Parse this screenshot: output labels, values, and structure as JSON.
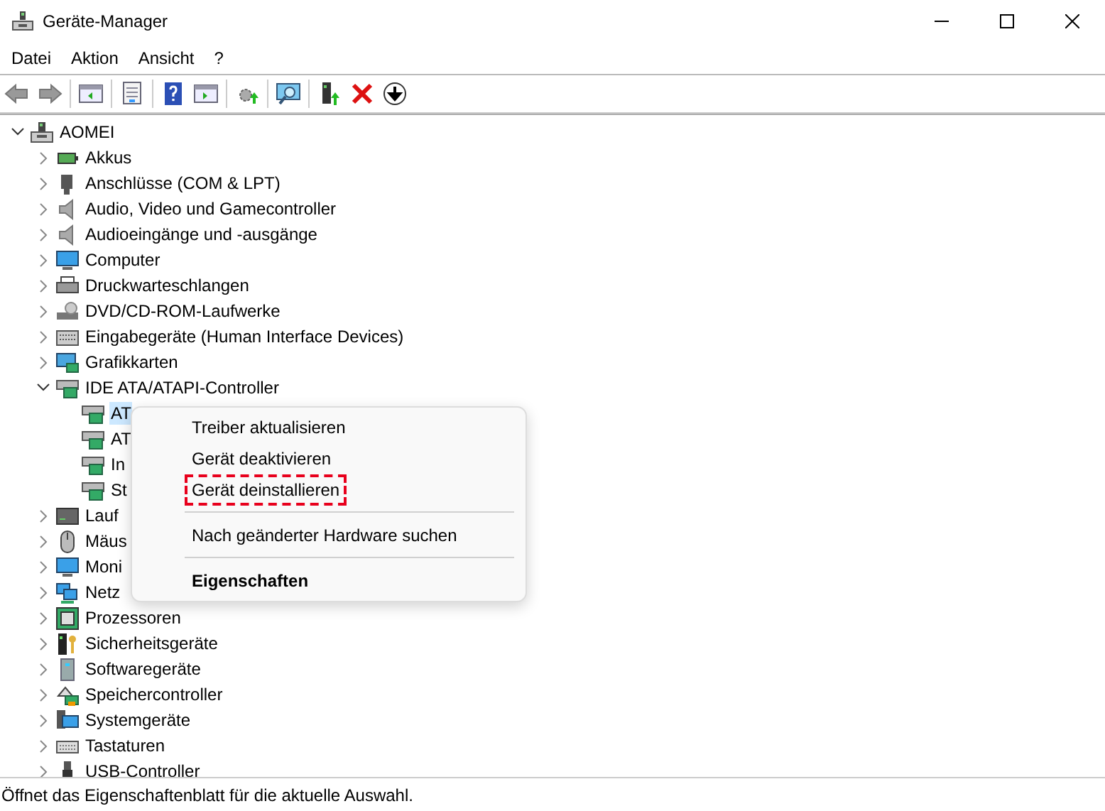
{
  "window": {
    "title": "Geräte-Manager"
  },
  "menu_bar": [
    "Datei",
    "Aktion",
    "Ansicht",
    "?"
  ],
  "tree": [
    {
      "label": "AOMEI",
      "expanded": true,
      "selected": false,
      "children": [
        {
          "label": "Akkus",
          "expanded": false,
          "selected": false
        },
        {
          "label": "Anschlüsse (COM & LPT)",
          "expanded": false,
          "selected": false
        },
        {
          "label": "Audio, Video und Gamecontroller",
          "expanded": false,
          "selected": false
        },
        {
          "label": "Audioeingänge und -ausgänge",
          "expanded": false,
          "selected": false
        },
        {
          "label": "Computer",
          "expanded": false,
          "selected": false
        },
        {
          "label": "Druckwarteschlangen",
          "expanded": false,
          "selected": false
        },
        {
          "label": "DVD/CD-ROM-Laufwerke",
          "expanded": false,
          "selected": false
        },
        {
          "label": "Eingabegeräte (Human Interface Devices)",
          "expanded": false,
          "selected": false
        },
        {
          "label": "Grafikkarten",
          "expanded": false,
          "selected": false
        },
        {
          "label": "IDE ATA/ATAPI-Controller",
          "expanded": true,
          "selected": false,
          "children": [
            {
              "label": "AT",
              "selected": true
            },
            {
              "label": "AT",
              "selected": false
            },
            {
              "label": "In",
              "selected": false
            },
            {
              "label": "St",
              "selected": false
            }
          ]
        },
        {
          "label": "Lauf",
          "expanded": false,
          "selected": false
        },
        {
          "label": "Mäus",
          "expanded": false,
          "selected": false
        },
        {
          "label": "Moni",
          "expanded": false,
          "selected": false
        },
        {
          "label": "Netz",
          "expanded": false,
          "selected": false
        },
        {
          "label": "Prozessoren",
          "expanded": false,
          "selected": false
        },
        {
          "label": "Sicherheitsgeräte",
          "expanded": false,
          "selected": false
        },
        {
          "label": "Softwaregeräte",
          "expanded": false,
          "selected": false
        },
        {
          "label": "Speichercontroller",
          "expanded": false,
          "selected": false
        },
        {
          "label": "Systemgeräte",
          "expanded": false,
          "selected": false
        },
        {
          "label": "Tastaturen",
          "expanded": false,
          "selected": false
        },
        {
          "label": "USB-Controller",
          "expanded": false,
          "selected": false
        }
      ]
    }
  ],
  "context_menu": [
    {
      "label": "Treiber aktualisieren",
      "kind": "item",
      "marked": false
    },
    {
      "label": "Gerät deaktivieren",
      "kind": "item",
      "marked": false
    },
    {
      "label": "Gerät deinstallieren",
      "kind": "item",
      "marked": true
    },
    {
      "kind": "separator"
    },
    {
      "label": "Nach geänderter Hardware suchen",
      "kind": "item",
      "marked": false
    },
    {
      "kind": "separator"
    },
    {
      "label": "Eigenschaften",
      "kind": "default",
      "marked": false
    }
  ],
  "status_bar": "Öffnet das Eigenschaftenblatt für die aktuelle Auswahl."
}
